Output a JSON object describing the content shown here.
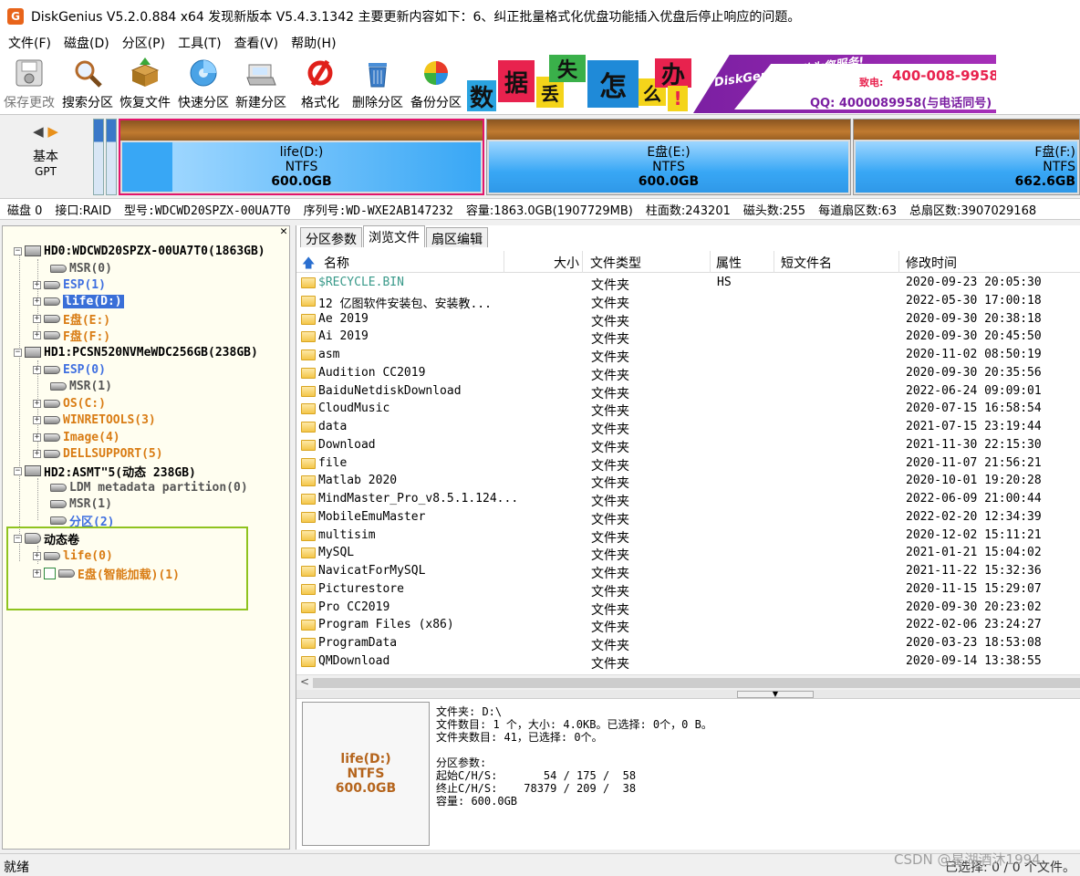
{
  "window": {
    "title": "DiskGenius V5.2.0.884 x64   发现新版本 V5.4.3.1342 主要更新内容如下：6、纠正批量格式化优盘功能插入优盘后停止响应的问题。",
    "app_icon": "G"
  },
  "menu": [
    "文件(F)",
    "磁盘(D)",
    "分区(P)",
    "工具(T)",
    "查看(V)",
    "帮助(H)"
  ],
  "toolbar": {
    "save": "保存更改",
    "search": "搜索分区",
    "recover": "恢复文件",
    "quick_partition": "快速分区",
    "new_partition": "新建分区",
    "format": "格式化",
    "delete_partition": "删除分区",
    "backup_partition": "备份分区"
  },
  "banner": {
    "tiles": [
      "数",
      "据",
      "丢",
      "失",
      "怎",
      "么",
      "办",
      "!"
    ],
    "team": "DiskGenius团队为您服务!",
    "phone_label": "致电:",
    "phone": "400-008-9958",
    "qq": "QQ: 4000089958(与电话同号)"
  },
  "diskmap": {
    "disk_type": "基本",
    "partition_style": "GPT",
    "partitions": [
      {
        "name": "life(D:)",
        "fs": "NTFS",
        "size": "600.0GB"
      },
      {
        "name": "E盘(E:)",
        "fs": "NTFS",
        "size": "600.0GB"
      },
      {
        "name": "F盘(F:)",
        "fs": "NTFS",
        "size": "662.6GB"
      }
    ]
  },
  "diskinfo": {
    "disk": "磁盘 0",
    "interface": "接口:RAID",
    "model": "型号:WDCWD20SPZX-00UA7T0",
    "serial": "序列号:WD-WXE2AB147232",
    "capacity": "容量:1863.0GB(1907729MB)",
    "cylinders": "柱面数:243201",
    "heads": "磁头数:255",
    "sectors_per_track": "每道扇区数:63",
    "total_sectors": "总扇区数:3907029168"
  },
  "tree": {
    "hd0": "HD0:WDCWD20SPZX-00UA7T0(1863GB)",
    "hd0_items": [
      "MSR(0)",
      "ESP(1)",
      "life(D:)",
      "E盘(E:)",
      "F盘(F:)"
    ],
    "hd1": "HD1:PCSN520NVMeWDC256GB(238GB)",
    "hd1_items": [
      "ESP(0)",
      "MSR(1)",
      "OS(C:)",
      "WINRETOOLS(3)",
      "Image(4)",
      "DELLSUPPORT(5)"
    ],
    "hd2": "HD2:ASMT\"5(动态 238GB)",
    "hd2_items": [
      "LDM metadata partition(0)",
      "MSR(1)",
      "分区(2)"
    ],
    "dyn": "动态卷",
    "dyn_items": [
      "life(0)",
      "E盘(智能加载)(1)"
    ]
  },
  "tabs": [
    "分区参数",
    "浏览文件",
    "扇区编辑"
  ],
  "columns": {
    "name": "名称",
    "size": "大小",
    "type": "文件类型",
    "attr": "属性",
    "short": "短文件名",
    "mtime": "修改时间"
  },
  "files": [
    {
      "name": "$RECYCLE.BIN",
      "type": "文件夹",
      "attr": "HS",
      "mtime": "2020-09-23 20:05:30"
    },
    {
      "name": "12 亿图软件安装包、安装教...",
      "type": "文件夹",
      "attr": "",
      "mtime": "2022-05-30 17:00:18"
    },
    {
      "name": "Ae 2019",
      "type": "文件夹",
      "attr": "",
      "mtime": "2020-09-30 20:38:18"
    },
    {
      "name": "Ai 2019",
      "type": "文件夹",
      "attr": "",
      "mtime": "2020-09-30 20:45:50"
    },
    {
      "name": "asm",
      "type": "文件夹",
      "attr": "",
      "mtime": "2020-11-02 08:50:19"
    },
    {
      "name": "Audition CC2019",
      "type": "文件夹",
      "attr": "",
      "mtime": "2020-09-30 20:35:56"
    },
    {
      "name": "BaiduNetdiskDownload",
      "type": "文件夹",
      "attr": "",
      "mtime": "2022-06-24 09:09:01"
    },
    {
      "name": "CloudMusic",
      "type": "文件夹",
      "attr": "",
      "mtime": "2020-07-15 16:58:54"
    },
    {
      "name": "data",
      "type": "文件夹",
      "attr": "",
      "mtime": "2021-07-15 23:19:44"
    },
    {
      "name": "Download",
      "type": "文件夹",
      "attr": "",
      "mtime": "2021-11-30 22:15:30"
    },
    {
      "name": "file",
      "type": "文件夹",
      "attr": "",
      "mtime": "2020-11-07 21:56:21"
    },
    {
      "name": "Matlab 2020",
      "type": "文件夹",
      "attr": "",
      "mtime": "2020-10-01 19:20:28"
    },
    {
      "name": "MindMaster_Pro_v8.5.1.124...",
      "type": "文件夹",
      "attr": "",
      "mtime": "2022-06-09 21:00:44"
    },
    {
      "name": "MobileEmuMaster",
      "type": "文件夹",
      "attr": "",
      "mtime": "2022-02-20 12:34:39"
    },
    {
      "name": "multisim",
      "type": "文件夹",
      "attr": "",
      "mtime": "2020-12-02 15:11:21"
    },
    {
      "name": "MySQL",
      "type": "文件夹",
      "attr": "",
      "mtime": "2021-01-21 15:04:02"
    },
    {
      "name": "NavicatForMySQL",
      "type": "文件夹",
      "attr": "",
      "mtime": "2021-11-22 15:32:36"
    },
    {
      "name": "Picturestore",
      "type": "文件夹",
      "attr": "",
      "mtime": "2020-11-15 15:29:07"
    },
    {
      "name": "Pro CC2019",
      "type": "文件夹",
      "attr": "",
      "mtime": "2020-09-30 20:23:02"
    },
    {
      "name": "Program Files (x86)",
      "type": "文件夹",
      "attr": "",
      "mtime": "2022-02-06 23:24:27"
    },
    {
      "name": "ProgramData",
      "type": "文件夹",
      "attr": "",
      "mtime": "2020-03-23 18:53:08"
    },
    {
      "name": "QMDownload",
      "type": "文件夹",
      "attr": "",
      "mtime": "2020-09-14 13:38:55"
    }
  ],
  "info": {
    "thumb_name": "life(D:)",
    "thumb_fs": "NTFS",
    "thumb_size": "600.0GB",
    "text": "文件夹: D:\\\n文件数目: 1 个，大小: 4.0KB。已选择: 0个，0 B。\n文件夹数目: 41，已选择: 0个。\n\n分区参数:\n起始C/H/S:       54 / 175 /  58\n终止C/H/S:    78379 / 209 /  38\n容量: 600.0GB"
  },
  "status": {
    "left": "就绪",
    "right": "已选择: 0 / 0 个文件。"
  },
  "watermark": "CSDN @星湖酒沐1994",
  "colors": {
    "accent_selection": "#3a6fd8",
    "partition_selected_border": "#e2156b",
    "highlight_box": "#8fc31f"
  }
}
